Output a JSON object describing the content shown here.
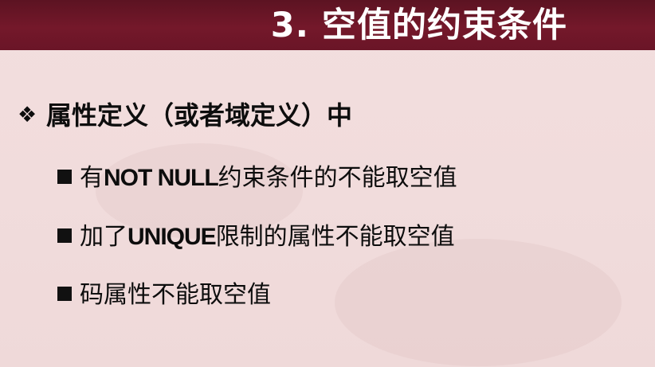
{
  "slide": {
    "title": "3. 空值的约束条件",
    "main_point": {
      "bullet": "❖",
      "text": "属性定义（或者域定义）中"
    },
    "sub_points": [
      {
        "pre": "有",
        "keyword": "NOT NULL",
        "post": "约束条件的不能取空值"
      },
      {
        "pre": "加了",
        "keyword": "UNIQUE",
        "post": "限制的属性不能取空值"
      },
      {
        "pre": "码属性不能取空值",
        "keyword": "",
        "post": ""
      }
    ]
  }
}
